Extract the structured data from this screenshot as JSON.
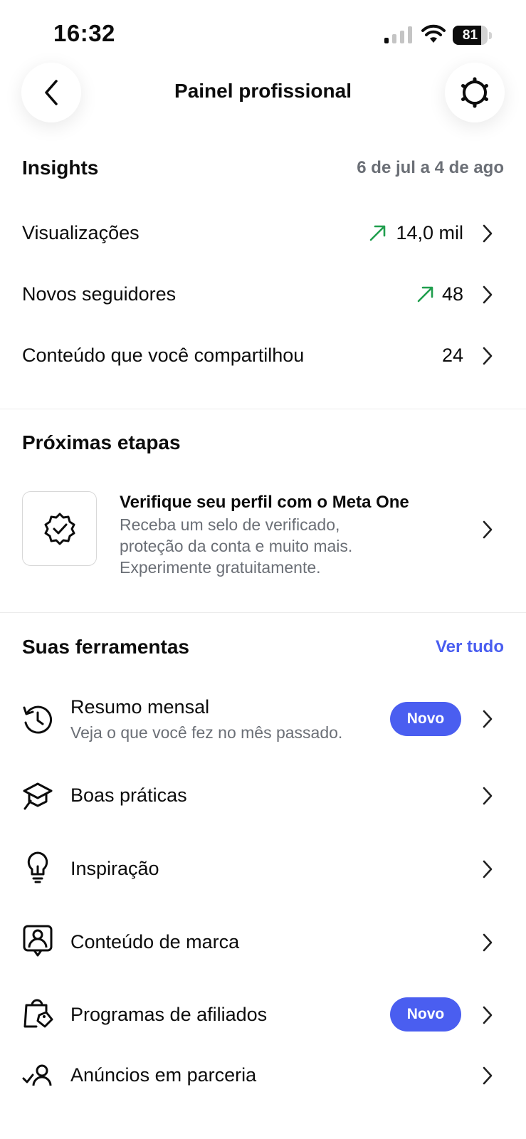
{
  "status_bar": {
    "time": "16:32",
    "battery_level": "81",
    "battery_fraction": 0.81
  },
  "header": {
    "title": "Painel profissional",
    "back_icon": "chevron-left-icon",
    "settings_icon": "gear-icon"
  },
  "insights": {
    "title": "Insights",
    "date_range": "6 de jul a 4 de ago",
    "rows": [
      {
        "label": "Visualizações",
        "value": "14,0 mil",
        "trend": "up"
      },
      {
        "label": "Novos seguidores",
        "value": "48",
        "trend": "up"
      },
      {
        "label": "Conteúdo que você compartilhou",
        "value": "24",
        "trend": "none"
      }
    ],
    "trend_color": "#1f9e4d"
  },
  "next_steps": {
    "title": "Próximas etapas",
    "card": {
      "icon": "verified-badge-icon",
      "title": "Verifique seu perfil com o Meta One",
      "description_lines": [
        "Receba um selo de verificado,",
        "proteção da conta e muito mais.",
        "Experimente gratuitamente."
      ]
    }
  },
  "tools": {
    "title": "Suas ferramentas",
    "see_all": "Ver tudo",
    "accent_color": "#4a5ef0",
    "items": [
      {
        "label": "Resumo mensal",
        "subtitle": "Veja o que você fez no mês passado.",
        "badge": "Novo",
        "icon": "history-icon"
      },
      {
        "label": "Boas práticas",
        "icon": "graduation-cap-icon"
      },
      {
        "label": "Inspiração",
        "icon": "lightbulb-icon"
      },
      {
        "label": "Conteúdo de marca",
        "icon": "branded-content-icon"
      },
      {
        "label": "Programas de afiliados",
        "badge": "Novo",
        "icon": "shopping-bag-tag-icon"
      },
      {
        "label": "Anúncios em parceria",
        "icon": "partner-ads-icon"
      }
    ]
  }
}
